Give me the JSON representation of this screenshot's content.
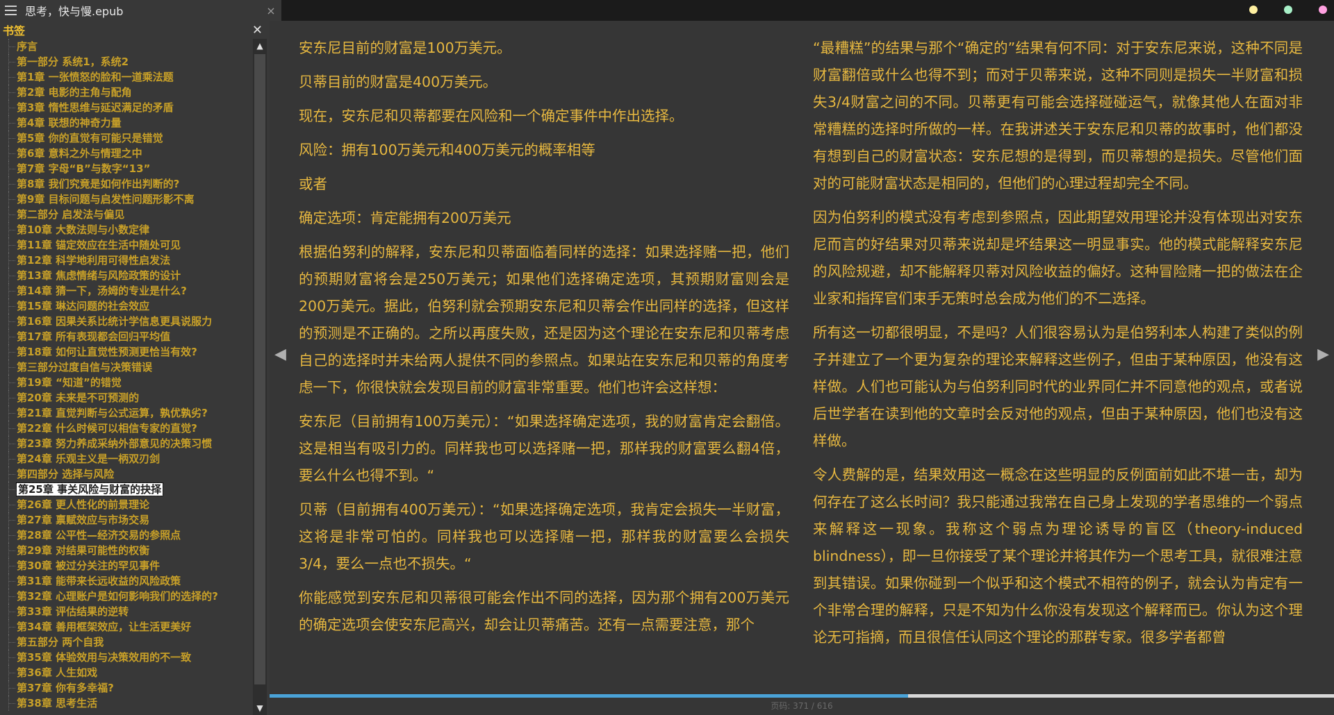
{
  "window": {
    "tab_title": "思考，快与慢.epub",
    "close_glyph": "×",
    "dot_colors": [
      "#fff0a0",
      "#a8f0c8",
      "#ffa0e0"
    ]
  },
  "sidebar": {
    "title": "书签",
    "close_glyph": "✕",
    "selected_index": 30,
    "items": [
      "序言",
      "第一部分 系统1，系统2",
      "第1章 一张愤怒的脸和一道乘法题",
      "第2章 电影的主角与配角",
      "第3章 惰性思维与延迟满足的矛盾",
      "第4章 联想的神奇力量",
      "第5章 你的直觉有可能只是错觉",
      "第6章 意料之外与情理之中",
      "第7章 字母“B”与数字“13”",
      "第8章 我们究竟是如何作出判断的?",
      "第9章 目标问题与启发性问题形影不离",
      "第二部分 启发法与偏见",
      "第10章 大数法则与小数定律",
      "第11章 锚定效应在生活中随处可见",
      "第12章 科学地利用可得性启发法",
      "第13章 焦虑情绪与风险政策的设计",
      "第14章 猜一下，汤姆的专业是什么?",
      "第15章 琳达问题的社会效应",
      "第16章 因果关系比统计学信息更具说服力",
      "第17章 所有表现都会回归平均值",
      "第18章 如何让直觉性预测更恰当有效?",
      "第三部分过度自信与决策错误",
      "第19章 “知道”的错觉",
      "第20章 未来是不可预测的",
      "第21章 直觉判断与公式运算，孰优孰劣?",
      "第22章 什么时候可以相信专家的直觉?",
      "第23章 努力养成采纳外部意见的决策习惯",
      "第24章 乐观主义是一柄双刃剑",
      "第四部分 选择与风险",
      "第25章 事关风险与财富的抉择",
      "第26章 更人性化的前景理论",
      "第27章 禀赋效应与市场交易",
      "第28章 公平性—经济交易的参照点",
      "第29章 对结果可能性的权衡",
      "第30章 被过分关注的罕见事件",
      "第31章 能带来长远收益的风险政策",
      "第32章 心理账户是如何影响我们的选择的?",
      "第33章 评估结果的逆转",
      "第34章 善用框架效应，让生活更美好",
      "第五部分 两个自我",
      "第35章 体验效用与决策效用的不一致",
      "第36章 人生如戏",
      "第37章 你有多幸福?",
      "第38章 思考生活"
    ],
    "scroll_up_glyph": "▲",
    "scroll_down_glyph": "▼"
  },
  "reader": {
    "prev_glyph": "◀",
    "next_glyph": "▶",
    "left_column": [
      "安东尼目前的财富是100万美元。",
      "贝蒂目前的财富是400万美元。",
      "现在，安东尼和贝蒂都要在风险和一个确定事件中作出选择。",
      "风险：拥有100万美元和400万美元的概率相等",
      "或者",
      "确定选项：肯定能拥有200万美元",
      "根据伯努利的解释，安东尼和贝蒂面临着同样的选择：如果选择赌一把，他们的预期财富将会是250万美元；如果他们选择确定选项，其预期财富则会是200万美元。据此，伯努利就会预期安东尼和贝蒂会作出同样的选择，但这样的预测是不正确的。之所以再度失败，还是因为这个理论在安东尼和贝蒂考虑自己的选择时并未给两人提供不同的参照点。如果站在安东尼和贝蒂的角度考虑一下，你很快就会发现目前的财富非常重要。他们也许会这样想：",
      "安东尼（目前拥有100万美元）：“如果选择确定选项，我的财富肯定会翻倍。这是相当有吸引力的。同样我也可以选择赌一把，那样我的财富要么翻4倍，要么什么也得不到。“",
      "贝蒂（目前拥有400万美元）：“如果选择确定选项，我肯定会损失一半财富，这将是非常可怕的。同样我也可以选择赌一把，那样我的财富要么会损失3/4，要么一点也不损失。“",
      "你能感觉到安东尼和贝蒂很可能会作出不同的选择，因为那个拥有200万美元的确定选项会使安东尼高兴，却会让贝蒂痛苦。还有一点需要注意，那个"
    ],
    "right_column": [
      "“最糟糕”的结果与那个“确定的”结果有何不同：对于安东尼来说，这种不同是财富翻倍或什么也得不到；而对于贝蒂来说，这种不同则是损失一半财富和损失3/4财富之间的不同。贝蒂更有可能会选择碰碰运气，就像其他人在面对非常糟糕的选择时所做的一样。在我讲述关于安东尼和贝蒂的故事时，他们都没有想到自己的财富状态：安东尼想的是得到，而贝蒂想的是损失。尽管他们面对的可能财富状态是相同的，但他们的心理过程却完全不同。",
      "因为伯努利的模式没有考虑到参照点，因此期望效用理论并没有体现出对安东尼而言的好结果对贝蒂来说却是坏结果这一明显事实。他的模式能解释安东尼的风险规避，却不能解释贝蒂对风险收益的偏好。这种冒险赌一把的做法在企业家和指挥官们束手无策时总会成为他们的不二选择。",
      "所有这一切都很明显，不是吗？人们很容易认为是伯努利本人构建了类似的例子并建立了一个更为复杂的理论来解释这些例子，但由于某种原因，他没有这样做。人们也可能认为与伯努利同时代的业界同仁并不同意他的观点，或者说后世学者在读到他的文章时会反对他的观点，但由于某种原因，他们也没有这样做。",
      "令人费解的是，结果效用这一概念在这些明显的反例面前如此不堪一击，却为何存在了这么长时间？我只能通过我常在自己身上发现的学者思维的一个弱点来解释这一现象。我称这个弱点为理论诱导的盲区（theory-induced blindness），即一旦你接受了某个理论并将其作为一个思考工具，就很难注意到其错误。如果你碰到一个似乎和这个模式不相符的例子，就会认为肯定有一个非常合理的解释，只是不知为什么你没有发现这个解释而已。你认为这个理论无可指摘，而且很信任认同这个理论的那群专家。很多学者都曾"
    ],
    "progress_fraction": 0.6,
    "page_number": "页码: 371 / 616",
    "accent_color": "#4aa3d8",
    "text_color": "#e7b840"
  }
}
